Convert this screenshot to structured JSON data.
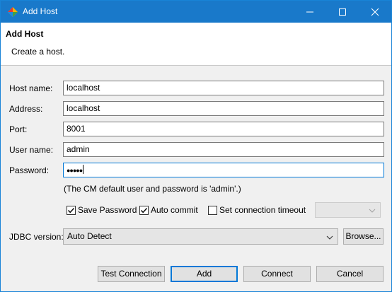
{
  "window": {
    "title": "Add Host"
  },
  "header": {
    "title": "Add Host",
    "description": "Create a host."
  },
  "form": {
    "host_name": {
      "label": "Host name:",
      "value": "localhost"
    },
    "address": {
      "label": "Address:",
      "value": "localhost"
    },
    "port": {
      "label": "Port:",
      "value": "8001"
    },
    "user_name": {
      "label": "User name:",
      "value": "admin"
    },
    "password": {
      "label": "Password:",
      "value": "●●●●●"
    },
    "hint": "(The CM default user and password is 'admin'.)"
  },
  "options": {
    "save_password": {
      "label": "Save Password",
      "checked": true
    },
    "auto_commit": {
      "label": "Auto commit",
      "checked": true
    },
    "set_connection_timeout": {
      "label": "Set connection timeout",
      "checked": false
    }
  },
  "jdbc": {
    "label": "JDBC version:",
    "value": "Auto Detect",
    "browse_label": "Browse..."
  },
  "buttons": {
    "test_connection": "Test Connection",
    "add": "Add",
    "connect": "Connect",
    "cancel": "Cancel"
  }
}
